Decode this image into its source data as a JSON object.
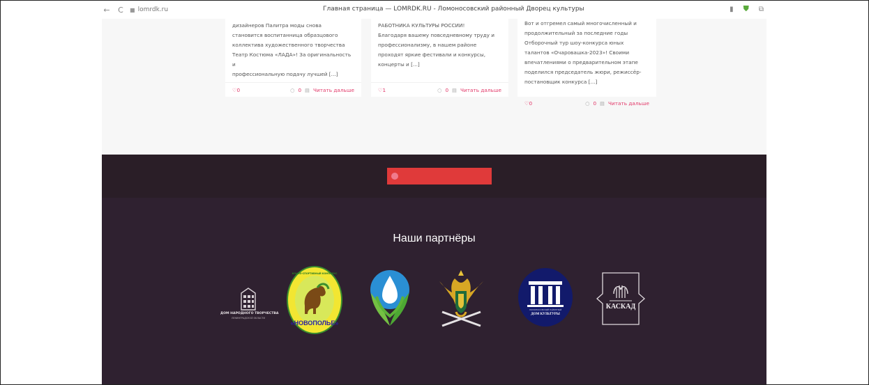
{
  "browser": {
    "back": "←",
    "reload": "C",
    "lock": "■",
    "url": "lomrdk.ru",
    "title": "Главная страница — LOMRDK.RU - Ломоносовский районный Дворец культуры"
  },
  "cards": [
    {
      "lines": [
        "дизайнеров Палитра моды снова",
        "становится воспитанница образцового",
        "коллектива художественного творчества",
        "Театр Костюма «ЛАДА»! За оригинальность и",
        "профессиональную подачу лучшей [...]"
      ],
      "likes": "♡0",
      "comments": "○",
      "comments_count": "0",
      "read_icon": "▤",
      "read_more": "Читать дальше"
    },
    {
      "lines": [
        "РАБОТНИКА КУЛЬТУРЫ РОССИИ!",
        "  Благодаря вашему повседневному труду и",
        "профессионализму, в нашем районе",
        "проходят яркие фестивали и конкурсы,",
        "концерты и [...]"
      ],
      "likes": "♡1",
      "comments": "○",
      "comments_count": "0",
      "read_icon": "▤",
      "read_more": "Читать дальше"
    },
    {
      "lines": [
        "Вот и отгремел самый многочисленный и",
        "продолжительный за последние годы",
        "Отборочный тур шоу-конкурса юных",
        "талантов «Очаровашка-2023»! Своими",
        "впечатлениями о предварительном этапе",
        "поделился председатель жюри, режиссёр-",
        "постановщик конкурса [...]"
      ],
      "likes": "♡0",
      "comments": "○",
      "comments_count": "0",
      "read_icon": "▤",
      "read_more": "Читать дальше"
    }
  ],
  "partners": {
    "title": "Наши партнёры",
    "logos": [
      {
        "name": "dom-narodnogo-tvorchestva",
        "text1": "ДОМ НАРОДНОГО ТВОРЧЕСТВА",
        "text2": "ЛЕНИНГРАДСКОЙ ОБЛАСТИ"
      },
      {
        "name": "novopolye",
        "text1": "«НОВОПОЛЬЕ»",
        "text2": "КОННО-СПОРТИВНЫЙ КОМПЛЕКС"
      },
      {
        "name": "hands-drop",
        "text1": ""
      },
      {
        "name": "eagle-emblem",
        "text1": ""
      },
      {
        "name": "dom-kultury",
        "text1": "ДОМ КУЛЬТУРЫ",
        "text2": "ЛОМОНОСОВСКИЙ РАЙОННЫЙ"
      },
      {
        "name": "kaskad",
        "text1": "КАСКАД"
      }
    ]
  },
  "colors": {
    "accent": "#e23a6a",
    "footer_top": "#2a1e27",
    "footer_main": "#2f2130",
    "red_button": "#e03a3a"
  }
}
